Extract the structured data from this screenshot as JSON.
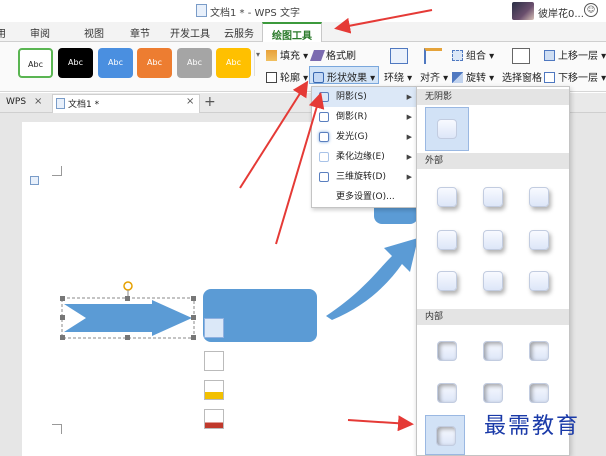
{
  "window": {
    "title": "文档1 * - WPS 文字",
    "user_name": "彼岸花0...",
    "user_menu_glyph": "☺"
  },
  "tabs": [
    {
      "label": "用"
    },
    {
      "label": "审阅"
    },
    {
      "label": "视图"
    },
    {
      "label": "章节"
    },
    {
      "label": "开发工具"
    },
    {
      "label": "云服务"
    },
    {
      "label": "绘图工具",
      "active": true
    }
  ],
  "ribbon": {
    "style_presets": [
      {
        "label": "Abc",
        "color": "#ffffff"
      },
      {
        "label": "Abc",
        "color": "#000000"
      },
      {
        "label": "Abc",
        "color": "#4a8fe0"
      },
      {
        "label": "Abc",
        "color": "#ed7d31"
      },
      {
        "label": "Abc",
        "color": "#a5a5a5"
      },
      {
        "label": "Abc",
        "color": "#ffc000"
      }
    ],
    "fill": "填充",
    "format_painter": "格式刷",
    "outline": "轮廓",
    "shape_effects": "形状效果",
    "wrap": "环绕",
    "align": "对齐",
    "group": "组合",
    "rotate": "旋转",
    "selection_pane": "选择窗格",
    "bring_forward": "上移一层",
    "send_backward": "下移一层"
  },
  "doc_tabs": [
    {
      "label": "WPS"
    },
    {
      "label": "文档1 *",
      "active": true
    }
  ],
  "new_tab_glyph": "+",
  "close_glyph": "×",
  "effects_menu": [
    {
      "label": "阴影(S)",
      "has_sub": true,
      "active": true
    },
    {
      "label": "倒影(R)",
      "has_sub": true
    },
    {
      "label": "发光(G)",
      "has_sub": true
    },
    {
      "label": "柔化边缘(E)",
      "has_sub": true
    },
    {
      "label": "三维旋转(D)",
      "has_sub": true
    },
    {
      "label": "更多设置(O)...",
      "has_sub": false
    }
  ],
  "shadow_panel": {
    "no_shadow": "无阴影",
    "outer": "外部",
    "inner": "内部"
  },
  "colors": {
    "accent_green": "#3c9a3c",
    "shape_blue": "#5b9bd5",
    "arrow_red": "#e53a36"
  },
  "watermark": "最需教育"
}
